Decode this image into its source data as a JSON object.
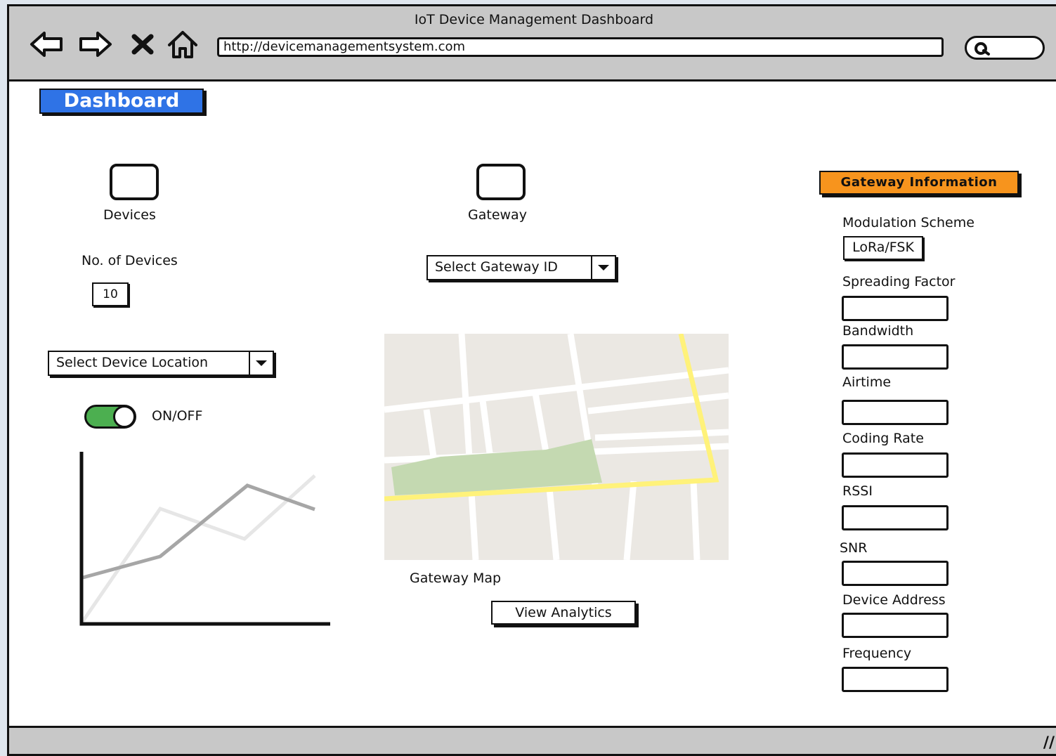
{
  "window": {
    "title": "IoT Device Management Dashboard",
    "url": "http://devicemanagementsystem.com"
  },
  "nav": {
    "back_icon": "arrow-left-icon",
    "forward_icon": "arrow-right-icon",
    "stop_icon": "close-icon",
    "home_icon": "home-icon",
    "search_icon": "search-icon"
  },
  "dashboard": {
    "button_label": "Dashboard",
    "color": "#2f73e6"
  },
  "devices": {
    "label": "Devices",
    "count_label": "No. of Devices",
    "count_value": "10",
    "location_select": "Select Device Location",
    "toggle_label": "ON/OFF",
    "toggle_on": true
  },
  "gateway": {
    "label": "Gateway",
    "id_select": "Select Gateway ID",
    "map_label": "Gateway Map",
    "analytics_button": "View Analytics"
  },
  "gateway_info": {
    "header": "Gateway Information",
    "header_color": "#f7941d",
    "fields": [
      {
        "label": "Modulation Scheme",
        "value": "LoRa/FSK"
      },
      {
        "label": "Spreading Factor",
        "value": ""
      },
      {
        "label": "Bandwidth",
        "value": ""
      },
      {
        "label": "Airtime",
        "value": ""
      },
      {
        "label": "Coding Rate",
        "value": ""
      },
      {
        "label": "RSSI",
        "value": ""
      },
      {
        "label": "SNR",
        "value": ""
      },
      {
        "label": "Device Address",
        "value": ""
      },
      {
        "label": "Frequency",
        "value": ""
      }
    ]
  }
}
